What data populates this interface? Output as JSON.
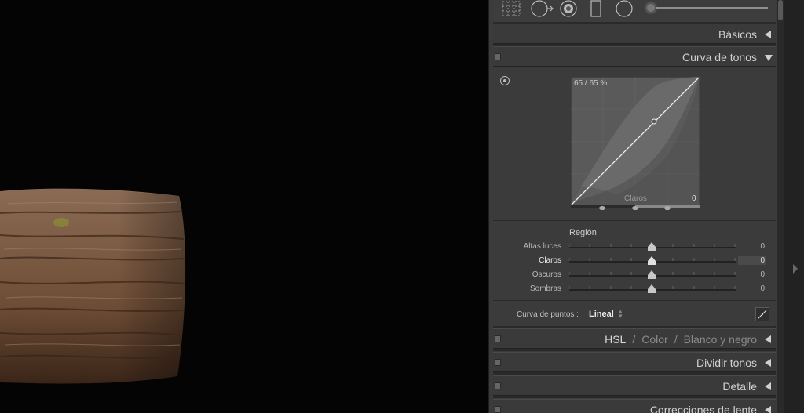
{
  "panels": {
    "basic": {
      "title": "Básicos"
    },
    "tone_curve": {
      "title": "Curva de tonos",
      "readout": "65 / 65 %",
      "region_label": "Claros",
      "region_value": "0",
      "region_heading": "Región",
      "sliders": [
        {
          "label": "Altas luces",
          "value": "0",
          "active": false
        },
        {
          "label": "Claros",
          "value": "0",
          "active": true
        },
        {
          "label": "Oscuros",
          "value": "0",
          "active": false
        },
        {
          "label": "Sombras",
          "value": "0",
          "active": false
        }
      ],
      "point_curve_label": "Curva de puntos :",
      "point_curve_value": "Lineal"
    },
    "hsl": {
      "tabs": [
        "HSL",
        "Color",
        "Blanco y negro"
      ],
      "active_tab": "HSL"
    },
    "split_toning": {
      "title": "Dividir tonos"
    },
    "detail": {
      "title": "Detalle"
    },
    "lens": {
      "title": "Correcciones de lente"
    }
  },
  "colors": {
    "panel_bg": "#3b3b3b",
    "header_text": "#d0d0d0",
    "photo_bg": "#040404",
    "wood": "#7a5a42"
  },
  "icons": [
    "crop-overlay-icon",
    "spot-removal-icon",
    "red-eye-icon",
    "graduated-filter-icon",
    "radial-filter-icon",
    "adjustment-brush-icon"
  ]
}
